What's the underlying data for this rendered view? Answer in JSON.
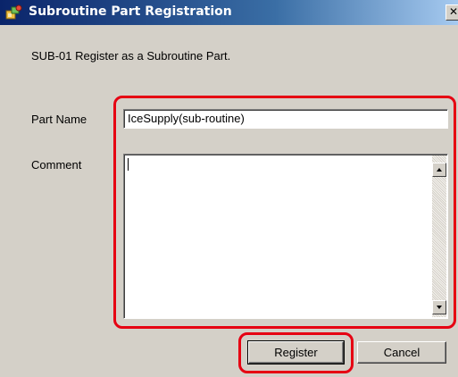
{
  "window": {
    "title": "Subroutine Part Registration",
    "close_glyph": "✕"
  },
  "instruction": "SUB-01 Register as a Subroutine Part.",
  "form": {
    "part_name_label": "Part Name",
    "part_name_value": "IceSupply(sub-routine)",
    "comment_label": "Comment",
    "comment_value": ""
  },
  "buttons": {
    "register_label": "Register",
    "cancel_label": "Cancel"
  },
  "colors": {
    "highlight": "#e60012",
    "titlebar_start": "#0a246a",
    "dialog_bg": "#d4d0c8"
  },
  "icons": {
    "title_icon": "parts-icon",
    "scroll_up": "scroll-up-arrow-icon",
    "scroll_down": "scroll-down-arrow-icon"
  }
}
